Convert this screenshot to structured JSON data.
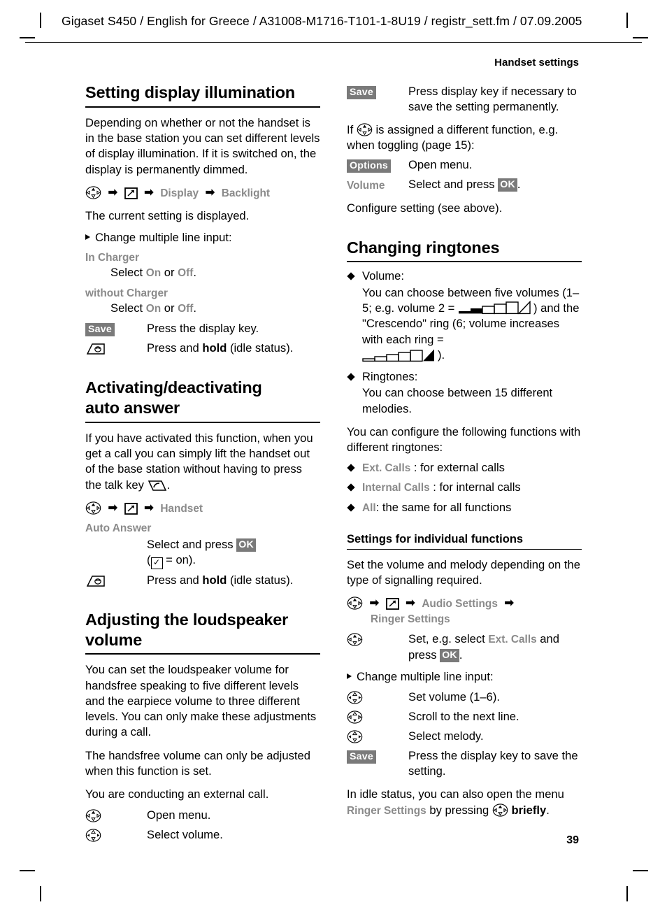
{
  "header": {
    "running_header": "Gigaset S450 / English for Greece / A31008-M1716-T101-1-8U19 / registr_sett.fm / 07.09.2005",
    "section_title": "Handset settings"
  },
  "footer": {
    "page_number": "39"
  },
  "left_column": {
    "s1": {
      "heading": "Setting display illumination",
      "intro": "Depending on whether or not the handset is in the base station you can set different levels of display illumination. If it is switched on, the display is permanently dimmed.",
      "path": {
        "item1": "Display",
        "item2": "Backlight"
      },
      "current": "The current setting is displayed.",
      "change_line": "Change multiple line input:",
      "in_charger": {
        "label": "In Charger",
        "select": "Select",
        "on": "On",
        "or": "or",
        "off": "Off",
        "period": "."
      },
      "without_charger": {
        "label": "without Charger",
        "select": "Select",
        "on": "On",
        "or": "or",
        "off": "Off",
        "period": "."
      },
      "rows": [
        {
          "key": "Save",
          "desc": "Press the display key."
        },
        {
          "key": "end-call-key-icon",
          "desc_pre": "Press and ",
          "desc_bold": "hold",
          "desc_post": " (idle status)."
        }
      ]
    },
    "s2": {
      "heading_line1": "Activating/deactivating",
      "heading_line2": "auto answer",
      "intro_pre": "If you have activated this function, when you get a call you can simply lift the handset out of the base station without having to press the talk key ",
      "intro_post": ".",
      "path": {
        "item1": "Handset"
      },
      "param_label": "Auto Answer",
      "row1": {
        "desc_pre": "Select and press ",
        "key": "OK",
        "line2_pre": "(",
        "line2_post": " = on)."
      },
      "row2": {
        "desc_pre": "Press and ",
        "desc_bold": "hold",
        "desc_post": " (idle status)."
      }
    },
    "s3": {
      "heading_line1": "Adjusting the loudspeaker",
      "heading_line2": "volume",
      "p1": "You can set the loudspeaker volume for handsfree speaking to five different levels and the earpiece volume to three different levels. You can only make these adjustments during a call.",
      "p2": "The handsfree volume can only be adjusted when this function is set.",
      "p3": "You are conducting an external call.",
      "rows": [
        {
          "desc": "Open menu."
        },
        {
          "desc": "Select volume."
        }
      ]
    }
  },
  "right_column": {
    "s1_cont": {
      "row_save": {
        "key": "Save",
        "desc": "Press display key if necessary to save the setting permanently."
      },
      "if_pre": "If ",
      "if_post": " is assigned a different function, e.g. when toggling (page 15):",
      "row_options": {
        "key": "Options",
        "desc": "Open menu."
      },
      "row_volume": {
        "label": "Volume",
        "desc_pre": "Select and press ",
        "key": "OK",
        "desc_post": "."
      },
      "configure": "Configure setting (see above)."
    },
    "s4": {
      "heading": "Changing ringtones",
      "b1": {
        "title": "Volume:",
        "text_pre": "You can choose between five volumes (1–5; e.g. volume 2 = ",
        "text_mid": ") and the \"Crescendo\" ring (6; volume increases with each ring =",
        "text_post": ")."
      },
      "b2": {
        "title": "Ringtones:",
        "text": "You can choose between 15 different melodies."
      },
      "config_text": "You can configure the following functions with different ringtones:",
      "items": [
        {
          "menu": "Ext. Calls",
          "rest": " : for external calls"
        },
        {
          "menu": "Internal Calls",
          "rest": " : for internal calls"
        },
        {
          "menu": "All",
          "rest": ": the same for all functions"
        }
      ]
    },
    "s5": {
      "heading": "Settings for individual functions",
      "intro": "Set the volume and melody depending on the type of signalling required.",
      "path": {
        "item1": "Audio Settings",
        "item2": "Ringer Settings"
      },
      "row_set": {
        "pre": "Set, e.g. select ",
        "menu": "Ext. Calls",
        "mid": " and press ",
        "key": "OK",
        "post": "."
      },
      "change_line": "Change multiple line input:",
      "rows": [
        {
          "desc": "Set volume (1–6)."
        },
        {
          "desc": "Scroll to the next line."
        },
        {
          "desc": "Select melody."
        }
      ],
      "row_save": {
        "key": "Save",
        "desc": "Press the display key to save the setting."
      },
      "idle_pre": "In idle status, you can also open the menu ",
      "idle_menu": "Ringer Settings",
      "idle_mid": " by pressing ",
      "idle_bold": "briefly",
      "idle_post": "."
    }
  },
  "colors": {
    "menu_grey": "#8a8a8a",
    "key_badge": "#7a7a7a",
    "text": "#000000"
  }
}
